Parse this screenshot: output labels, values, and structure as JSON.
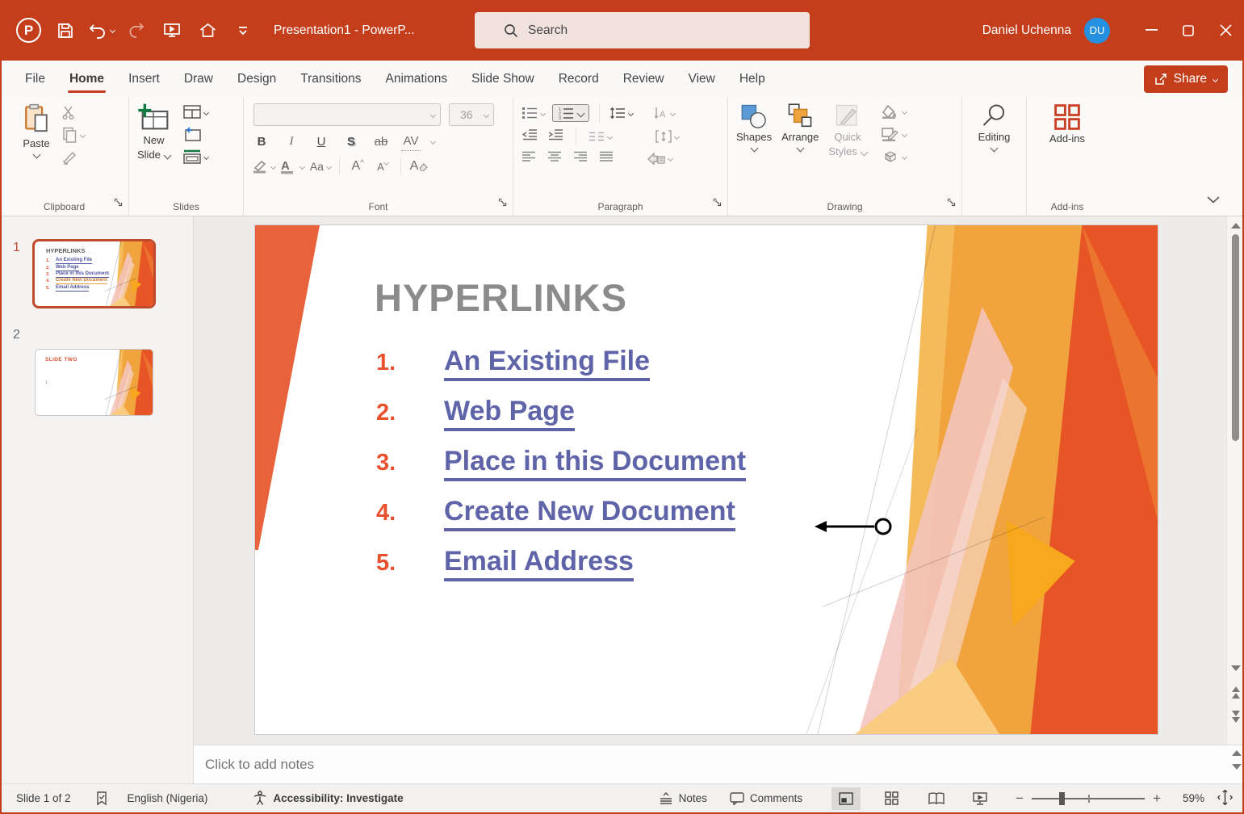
{
  "titlebar": {
    "document_title": "Presentation1  -  PowerP...",
    "search_placeholder": "Search",
    "user_name": "Daniel Uchenna",
    "user_initials": "DU"
  },
  "menu": {
    "tabs": [
      "File",
      "Home",
      "Insert",
      "Draw",
      "Design",
      "Transitions",
      "Animations",
      "Slide Show",
      "Record",
      "Review",
      "View",
      "Help"
    ],
    "active_tab": "Home",
    "share_label": "Share"
  },
  "ribbon": {
    "clipboard": {
      "group_label": "Clipboard",
      "paste_label": "Paste"
    },
    "slides": {
      "group_label": "Slides",
      "new_slide_line1": "New",
      "new_slide_line2": "Slide"
    },
    "font": {
      "group_label": "Font",
      "size_value": "36",
      "bold": "B",
      "italic": "I",
      "underline": "U",
      "shadow": "S",
      "strikethrough": "ab",
      "char_spacing": "AV",
      "change_case": "Aa",
      "grow_font": "A",
      "shrink_font": "A",
      "clear_format": "A"
    },
    "paragraph": {
      "group_label": "Paragraph"
    },
    "drawing": {
      "group_label": "Drawing",
      "shapes_label": "Shapes",
      "arrange_label": "Arrange",
      "quick_styles_line1": "Quick",
      "quick_styles_line2": "Styles"
    },
    "editing": {
      "label": "Editing"
    },
    "addins": {
      "group_label": "Add-ins",
      "button_label": "Add-ins"
    }
  },
  "thumbnails": {
    "slide1": {
      "number": "1"
    },
    "slide2": {
      "number": "2",
      "title": "SLIDE TWO",
      "marker": "1."
    }
  },
  "slide": {
    "title": "HYPERLINKS",
    "items": [
      {
        "num": "1.",
        "text": "An Existing File"
      },
      {
        "num": "2.",
        "text": "Web Page"
      },
      {
        "num": "3.",
        "text": "Place in this Document"
      },
      {
        "num": "4.",
        "text": "Create New Document"
      },
      {
        "num": "5.",
        "text": "Email Address"
      }
    ]
  },
  "notes": {
    "placeholder": "Click to add notes"
  },
  "statusbar": {
    "slide_indicator": "Slide 1 of 2",
    "language": "English (Nigeria)",
    "accessibility_status": "Accessibility: Investigate",
    "notes_label": "Notes",
    "comments_label": "Comments",
    "zoom_level": "59%"
  },
  "colors": {
    "titlebar": "#C43E1C",
    "accent": "#C43E1C",
    "hyperlink": "#5F63A8",
    "list_number": "#E8502E",
    "slide_title_gray": "#8B8B8B",
    "decor_amber": "#F1A43E",
    "decor_deep_orange": "#E75425",
    "avatar_blue": "#2590E0"
  }
}
